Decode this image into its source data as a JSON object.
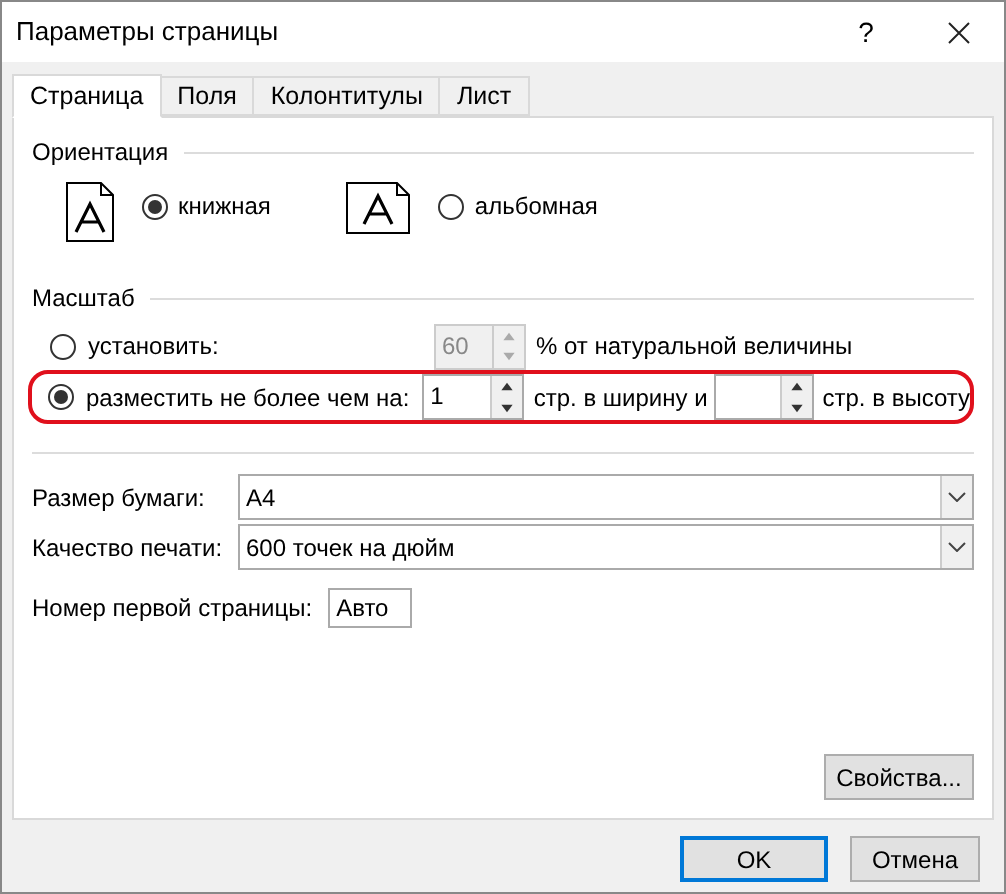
{
  "window": {
    "title": "Параметры страницы",
    "help": "?"
  },
  "tabs": [
    {
      "label": "Страница",
      "selected": true
    },
    {
      "label": "Поля",
      "selected": false
    },
    {
      "label": "Колонтитулы",
      "selected": false
    },
    {
      "label": "Лист",
      "selected": false
    }
  ],
  "orientation": {
    "title": "Ориентация",
    "options": [
      {
        "label": "книжная",
        "kind": "portrait",
        "selected": true
      },
      {
        "label": "альбомная",
        "kind": "landscape",
        "selected": false
      }
    ]
  },
  "scale": {
    "title": "Масштаб",
    "adjust": {
      "label": "установить:",
      "selected": false,
      "value": "60",
      "disabled": true,
      "suffix": "% от натуральной величины"
    },
    "fit": {
      "label": "разместить не более чем на:",
      "selected": true,
      "highlighted": true,
      "wide_value": "1",
      "wide_suffix": "стр. в ширину и",
      "tall_suffix": "стр. в высоту"
    }
  },
  "paper_size": {
    "label": "Размер бумаги:",
    "value": "A4"
  },
  "print_quality": {
    "label": "Качество печати:",
    "value": "600 точек на дюйм"
  },
  "first_page_number": {
    "label": "Номер первой страницы:",
    "value": "Авто"
  },
  "buttons": {
    "properties": "Свойства...",
    "ok": "OK",
    "cancel": "Отмена"
  }
}
